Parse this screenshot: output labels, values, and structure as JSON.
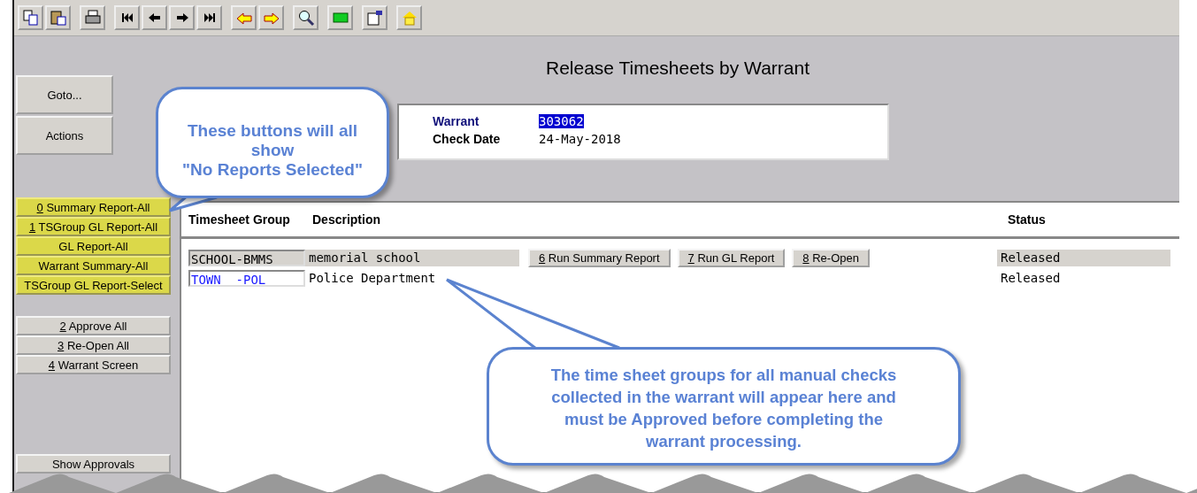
{
  "toolbar": [
    {
      "kind": "copy"
    },
    {
      "kind": "paste"
    },
    {
      "kind": "print"
    },
    {
      "kind": "first"
    },
    {
      "kind": "prev"
    },
    {
      "kind": "next"
    },
    {
      "kind": "last"
    },
    {
      "kind": "back"
    },
    {
      "kind": "forward"
    },
    {
      "kind": "search"
    },
    {
      "kind": "grid"
    },
    {
      "kind": "form"
    },
    {
      "kind": "home"
    }
  ],
  "title": "Release Timesheets by Warrant",
  "side_buttons": [
    {
      "label": "Goto..."
    },
    {
      "label": "Actions"
    }
  ],
  "report_buttons": [
    {
      "key": "0",
      "label": " Summary Report-All"
    },
    {
      "key": "1",
      "label": " TSGroup GL Report-All"
    },
    {
      "label": "GL Report-All"
    },
    {
      "label": "Warrant Summary-All"
    },
    {
      "label": "TSGroup GL Report-Select"
    }
  ],
  "action_buttons": [
    {
      "key": "2",
      "label": " Approve All"
    },
    {
      "key": "3",
      "label": " Re-Open All"
    },
    {
      "key": "4",
      "label": " Warrant Screen"
    }
  ],
  "show_approvals": "Show Approvals",
  "info": {
    "warrant_label": "Warrant",
    "warrant_value": "303062",
    "check_date_label": "Check Date",
    "check_date_value": "24-May-2018"
  },
  "columns": [
    "Timesheet Group",
    "Description",
    "Status"
  ],
  "rows": [
    {
      "group": "SCHOOL-BMMS",
      "description": "memorial school",
      "status": "Released",
      "selected": true,
      "buttons": [
        {
          "key": "6",
          "label": " Run Summary Report"
        },
        {
          "key": "7",
          "label": " Run GL Report"
        },
        {
          "key": "8",
          "label": " Re-Open"
        }
      ]
    },
    {
      "group": "TOWN  -POL",
      "description": "Police Department",
      "status": "Released",
      "selected": false,
      "buttons": []
    }
  ],
  "callouts": [
    "These buttons will all\nshow\n\"No Reports Selected\"",
    "The time sheet groups for all manual  checks\ncollected in the warrant will appear here and\nmust be Approved before completing the\nwarrant processing."
  ]
}
